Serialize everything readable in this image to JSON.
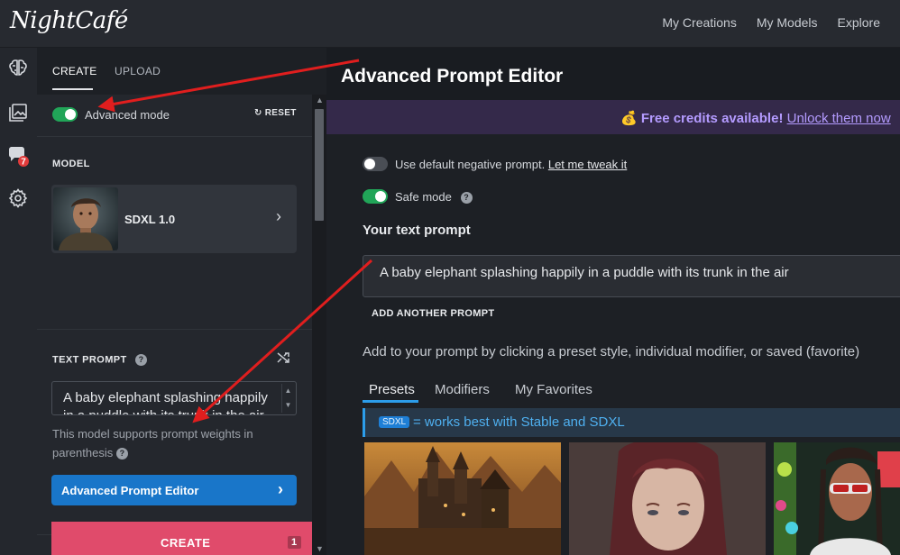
{
  "app": {
    "logo_text": "NightCafé"
  },
  "topnav": {
    "items": [
      "My Creations",
      "My Models",
      "Explore"
    ]
  },
  "rail": {
    "icons": [
      "brain-icon",
      "gallery-icon",
      "chat-icon",
      "gear-icon"
    ],
    "chat_badge": "7"
  },
  "panel": {
    "tabs": {
      "create": "CREATE",
      "upload": "UPLOAD"
    },
    "advanced_mode": {
      "label": "Advanced mode",
      "on": true
    },
    "reset_label": "RESET",
    "model_section": {
      "label": "MODEL",
      "name": "SDXL 1.0"
    },
    "text_prompt": {
      "label": "TEXT PROMPT",
      "value": "A baby elephant splashing happily in a puddle with its trunk in the air",
      "weights_note": "This model supports prompt weights in parenthesis"
    },
    "ape_button": "Advanced Prompt Editor",
    "create_button": "CREATE",
    "create_count": "1"
  },
  "main": {
    "title": "Advanced Prompt Editor",
    "banner": {
      "emoji": "💰",
      "bold_text": "Free credits available!",
      "link_text": "Unlock them now"
    },
    "negative_prompt": {
      "label": "Use default negative prompt.",
      "link": "Let me tweak it",
      "on": false
    },
    "safe_mode": {
      "label": "Safe mode",
      "on": true
    },
    "your_prompt_label": "Your text prompt",
    "prompt_value": "A baby elephant splashing happily in a puddle with its trunk in the air",
    "add_prompt_label": "ADD ANOTHER PROMPT",
    "instructions": "Add to your prompt by clicking a preset style, individual modifier, or saved (favorite)",
    "tabs": [
      "Presets",
      "Modifiers",
      "My Favorites"
    ],
    "active_tab": "Presets",
    "sdxl_badge": "SDXL",
    "sdxl_note": "= works best with Stable and SDXL"
  },
  "colors": {
    "accent_green": "#21a558",
    "primary_blue": "#1976c9",
    "create_pink": "#e04b6b",
    "annotation_red": "#e01e1e",
    "banner_purple": "#b49bff"
  }
}
